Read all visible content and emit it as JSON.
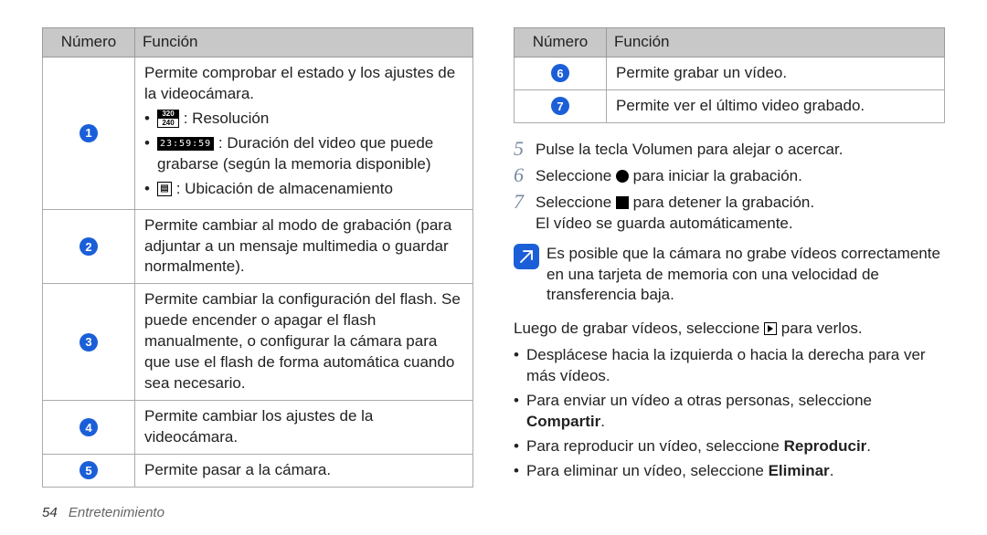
{
  "tables": {
    "left": {
      "headers": {
        "num": "Número",
        "func": "Función"
      },
      "rows": [
        {
          "n": "1",
          "intro": "Permite comprobar el estado y los ajustes de la videocámara.",
          "bullets": [
            {
              "icon": "res",
              "text": " : Resolución"
            },
            {
              "icon": "time",
              "text": " : Duración del video que puede grabarse (según la memoria disponible)"
            },
            {
              "icon": "store",
              "text": " : Ubicación de almacenamiento"
            }
          ]
        },
        {
          "n": "2",
          "text": "Permite cambiar al modo de grabación (para adjuntar a un mensaje multimedia o guardar normalmente)."
        },
        {
          "n": "3",
          "text": "Permite cambiar la configuración del flash. Se puede encender o apagar el flash manualmente, o configurar la cámara para que use el flash de forma automática cuando sea necesario."
        },
        {
          "n": "4",
          "text": "Permite cambiar los ajustes de la videocámara."
        },
        {
          "n": "5",
          "text": "Permite pasar a la cámara."
        }
      ]
    },
    "right": {
      "headers": {
        "num": "Número",
        "func": "Función"
      },
      "rows": [
        {
          "n": "6",
          "text": "Permite grabar un vídeo."
        },
        {
          "n": "7",
          "text": "Permite ver el último video grabado."
        }
      ]
    }
  },
  "steps": [
    {
      "n": "5",
      "pre": "Pulse la tecla Volumen para alejar o acercar."
    },
    {
      "n": "6",
      "pre": "Seleccione ",
      "icon": "rec",
      "post": " para iniciar la grabación."
    },
    {
      "n": "7",
      "pre": "Seleccione ",
      "icon": "stop",
      "post": " para detener la grabación.",
      "extra": "El vídeo se guarda automáticamente."
    }
  ],
  "note": "Es posible que la cámara no grabe vídeos correctamente en una tarjeta de memoria con una velocidad de transferencia baja.",
  "postNote": {
    "lead_pre": "Luego de grabar vídeos, seleccione ",
    "lead_post": " para verlos.",
    "items": [
      {
        "text": "Desplácese hacia la izquierda o hacia la derecha para ver más vídeos."
      },
      {
        "text": "Para enviar un vídeo a otras personas, seleccione ",
        "bold": "Compartir",
        "after": "."
      },
      {
        "text": "Para reproducir un vídeo, seleccione ",
        "bold": "Reproducir",
        "after": "."
      },
      {
        "text": "Para eliminar un vídeo, seleccione ",
        "bold": "Eliminar",
        "after": "."
      }
    ]
  },
  "footer": {
    "page": "54",
    "section": "Entretenimiento"
  },
  "iconText": {
    "res_top": "320",
    "res_bot": "240",
    "time": "23:59:59",
    "store": "▣"
  }
}
